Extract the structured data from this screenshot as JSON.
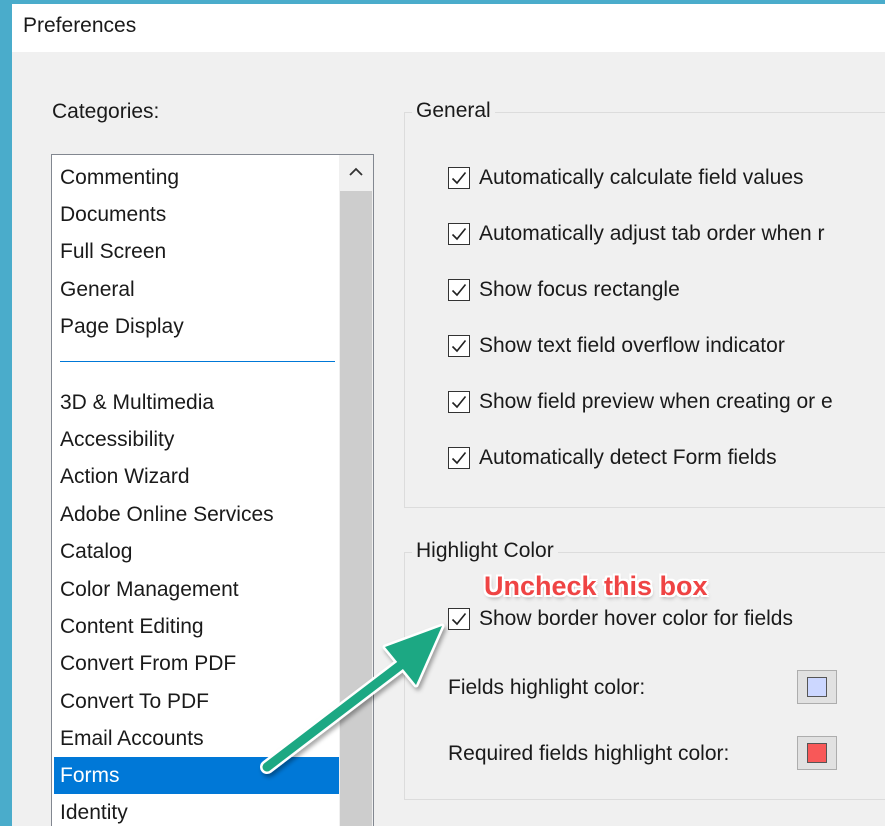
{
  "window": {
    "title": "Preferences"
  },
  "categories": {
    "label": "Categories:",
    "top_items": [
      "Commenting",
      "Documents",
      "Full Screen",
      "General",
      "Page Display"
    ],
    "items": [
      "3D & Multimedia",
      "Accessibility",
      "Action Wizard",
      "Adobe Online Services",
      "Catalog",
      "Color Management",
      "Content Editing",
      "Convert From PDF",
      "Convert To PDF",
      "Email Accounts",
      "Forms",
      "Identity"
    ],
    "selected": "Forms"
  },
  "general": {
    "title": "General",
    "options": [
      {
        "label": "Automatically calculate field values",
        "checked": true
      },
      {
        "label": "Automatically adjust tab order when r",
        "checked": true
      },
      {
        "label": "Show focus rectangle",
        "checked": true
      },
      {
        "label": "Show text field overflow indicator",
        "checked": true
      },
      {
        "label": "Show field preview when creating or e",
        "checked": true
      },
      {
        "label": "Automatically detect Form fields",
        "checked": true
      }
    ]
  },
  "highlight": {
    "title": "Highlight Color",
    "border_hover": {
      "label": "Show border hover color for fields",
      "checked": true
    },
    "fields_label": "Fields highlight color:",
    "fields_color": "#ccd7ff",
    "required_label": "Required fields highlight color:",
    "required_color": "#f85858"
  },
  "annotation": {
    "text": "Uncheck this box",
    "text_color": "#ef4444",
    "arrow_color": "#1aa883"
  },
  "colors": {
    "background": "#4aaccb",
    "selection": "#0078d7",
    "dialog": "#f0f0f0"
  }
}
